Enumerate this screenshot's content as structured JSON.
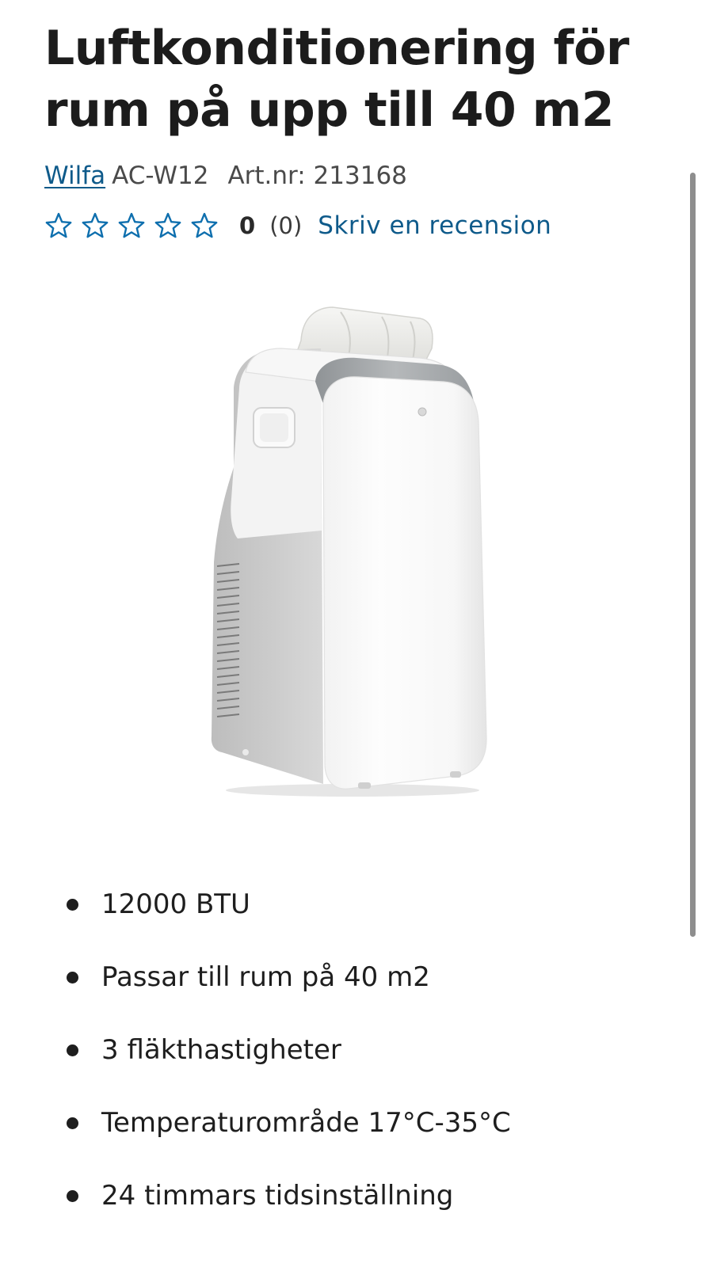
{
  "product": {
    "title": "Luftkonditionering för rum på upp till 40 m2",
    "brand": "Wilfa",
    "model": "AC-W12",
    "article_number": "Art.nr: 213168"
  },
  "rating": {
    "stars_filled": 0,
    "stars_total": 5,
    "value": "0",
    "count": "(0)",
    "write_review_label": "Skriv en recension",
    "star_color": "#0e6fae",
    "link_color": "#0e5a8a"
  },
  "image": {
    "icon": "portable-air-conditioner"
  },
  "features": [
    "12000 BTU",
    "Passar till rum på 40 m2",
    "3 fläkthastigheter",
    "Temperaturområde 17°C-35°C",
    "24 timmars tidsinställning"
  ]
}
